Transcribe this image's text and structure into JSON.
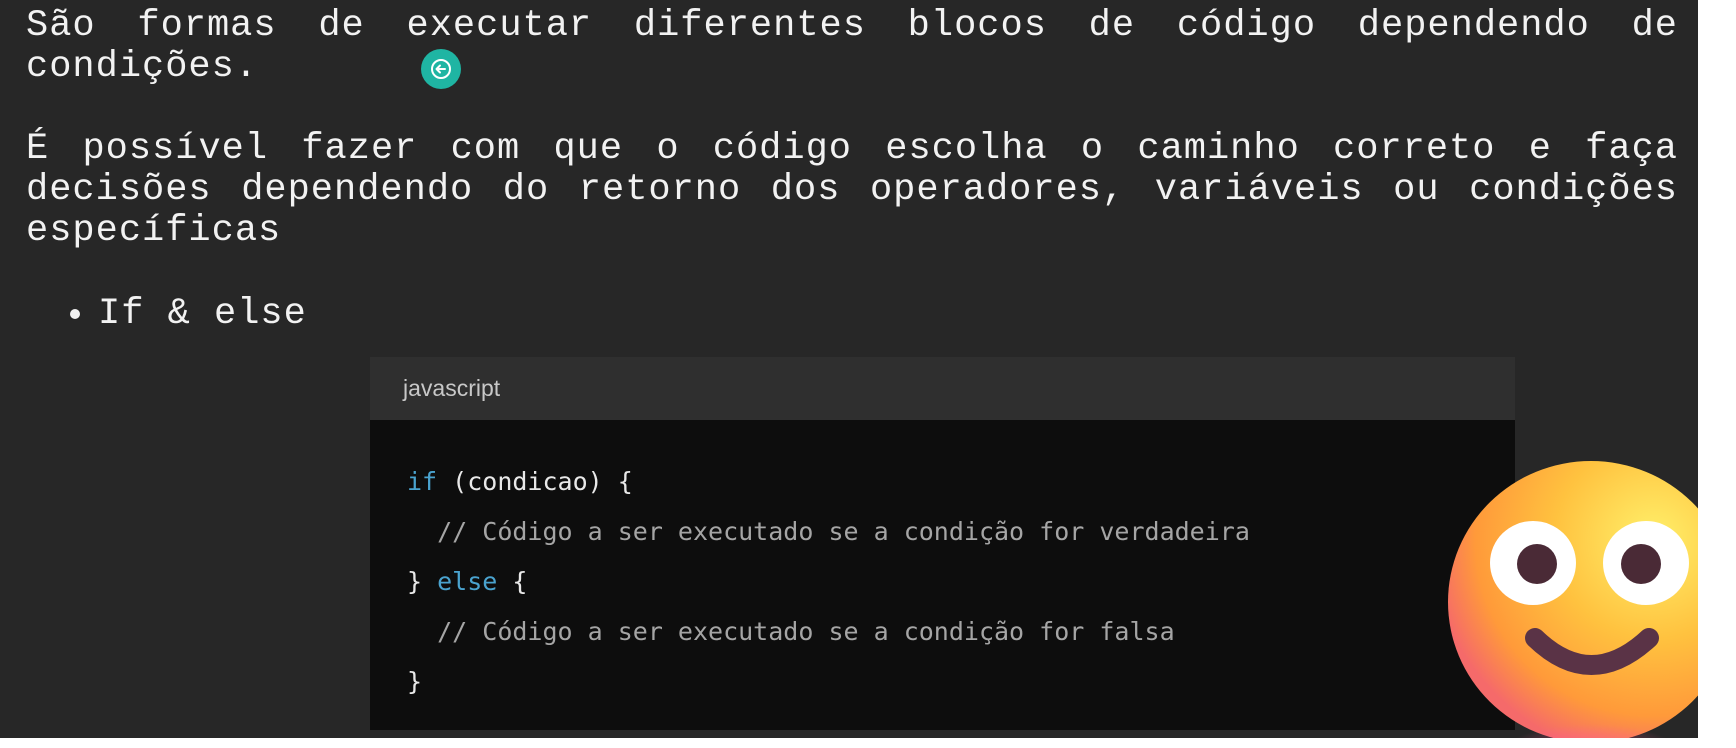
{
  "slide": {
    "paragraph_1": "São formas de executar diferentes blocos de código dependendo de condições.",
    "paragraph_2": "É possível fazer com que o código escolha o caminho correto  e faça decisões dependendo do retorno dos operadores, variáveis ou condições específicas",
    "bullets": [
      "If & else"
    ]
  },
  "code_block": {
    "language": "javascript",
    "lines": [
      {
        "kw": "if",
        "text": " (condicao) {",
        "comment": ""
      },
      {
        "kw": "",
        "text": "  ",
        "comment": "// Código a ser executado se a condição for verdadeira"
      },
      {
        "kw": "else",
        "text_before": "} ",
        "text": " {",
        "comment": ""
      },
      {
        "kw": "",
        "text": "  ",
        "comment": "// Código a ser executado se a condição for falsa"
      },
      {
        "kw": "",
        "text": "}",
        "comment": ""
      }
    ]
  },
  "icons": {
    "back_button": "arrow-left-icon",
    "emoji": "smiling-face-emoji"
  },
  "colors": {
    "background": "#272727",
    "text": "#f2f2f2",
    "accent_button": "#1fb5a3",
    "code_background": "#0d0d0d",
    "code_header": "#2f2f2f",
    "keyword": "#4aa3cf",
    "comment": "#a5a5a5"
  }
}
